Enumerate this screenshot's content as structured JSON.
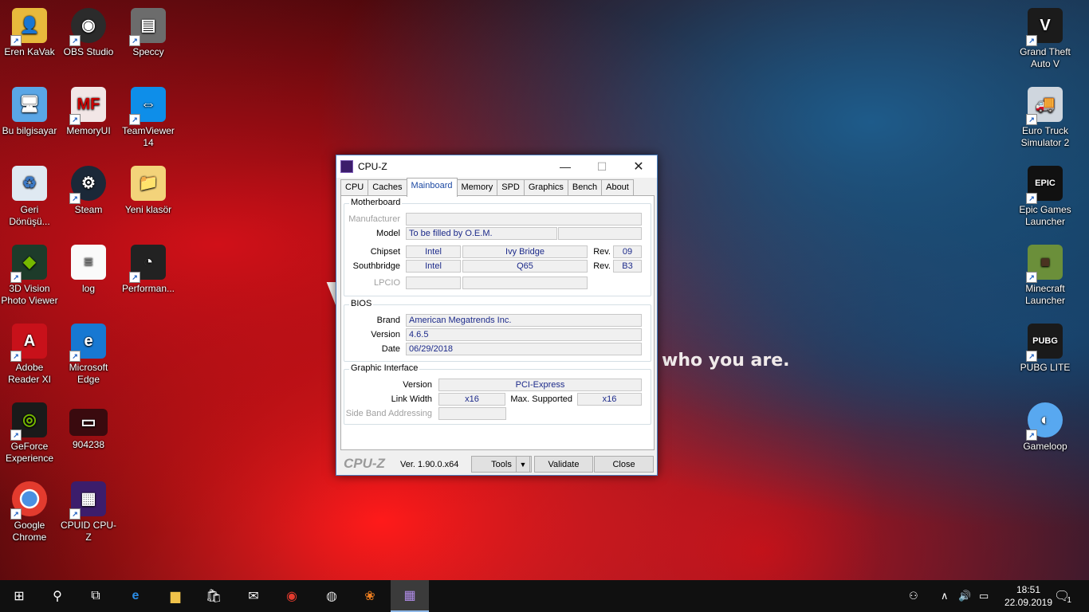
{
  "wallpaper": {
    "text": "vak",
    "sub": "who you are."
  },
  "desktop_icons": [
    {
      "label": "Eren KaVak"
    },
    {
      "label": "OBS Studio"
    },
    {
      "label": "Speccy"
    },
    {
      "label": "Bu bilgisayar"
    },
    {
      "label": "MemoryUI"
    },
    {
      "label": "TeamViewer 14"
    },
    {
      "label": "Geri Dönüşü..."
    },
    {
      "label": "Steam"
    },
    {
      "label": "Yeni klasör"
    },
    {
      "label": "3D Vision Photo Viewer"
    },
    {
      "label": "log"
    },
    {
      "label": "Performan..."
    },
    {
      "label": "Adobe Reader XI"
    },
    {
      "label": "Microsoft Edge"
    },
    {
      "label": "GeForce Experience"
    },
    {
      "label": "904238"
    },
    {
      "label": "Google Chrome"
    },
    {
      "label": "CPUID CPU-Z"
    },
    {
      "label": "Grand Theft Auto V"
    },
    {
      "label": "Euro Truck Simulator 2"
    },
    {
      "label": "Epic Games Launcher"
    },
    {
      "label": "Minecraft Launcher"
    },
    {
      "label": "PUBG LITE"
    },
    {
      "label": "Gameloop"
    }
  ],
  "window": {
    "title": "CPU-Z",
    "tabs": [
      "CPU",
      "Caches",
      "Mainboard",
      "Memory",
      "SPD",
      "Graphics",
      "Bench",
      "About"
    ],
    "active_tab": "Mainboard",
    "motherboard": {
      "legend": "Motherboard",
      "manufacturer_label": "Manufacturer",
      "manufacturer_value": "",
      "model_label": "Model",
      "model_value": "To be filled by O.E.M.",
      "model_value2": "",
      "chipset_label": "Chipset",
      "chipset_vendor": "Intel",
      "chipset_name": "Ivy Bridge",
      "chipset_rev_label": "Rev.",
      "chipset_rev": "09",
      "southbridge_label": "Southbridge",
      "southbridge_vendor": "Intel",
      "southbridge_name": "Q65",
      "southbridge_rev_label": "Rev.",
      "southbridge_rev": "B3",
      "lpcio_label": "LPCIO",
      "lpcio_vendor": "",
      "lpcio_name": ""
    },
    "bios": {
      "legend": "BIOS",
      "brand_label": "Brand",
      "brand_value": "American Megatrends Inc.",
      "version_label": "Version",
      "version_value": "4.6.5",
      "date_label": "Date",
      "date_value": "06/29/2018"
    },
    "graphic_interface": {
      "legend": "Graphic Interface",
      "version_label": "Version",
      "version_value": "PCI-Express",
      "link_width_label": "Link Width",
      "link_width_value": "x16",
      "max_supported_label": "Max. Supported",
      "max_supported_value": "x16",
      "sba_label": "Side Band Addressing",
      "sba_value": ""
    },
    "footer": {
      "logo": "CPU-Z",
      "version": "Ver. 1.90.0.x64",
      "tools_label": "Tools",
      "validate_label": "Validate",
      "close_label": "Close"
    }
  },
  "taskbar": {
    "time": "18:51",
    "date": "22.09.2019",
    "notification_count": "1"
  }
}
